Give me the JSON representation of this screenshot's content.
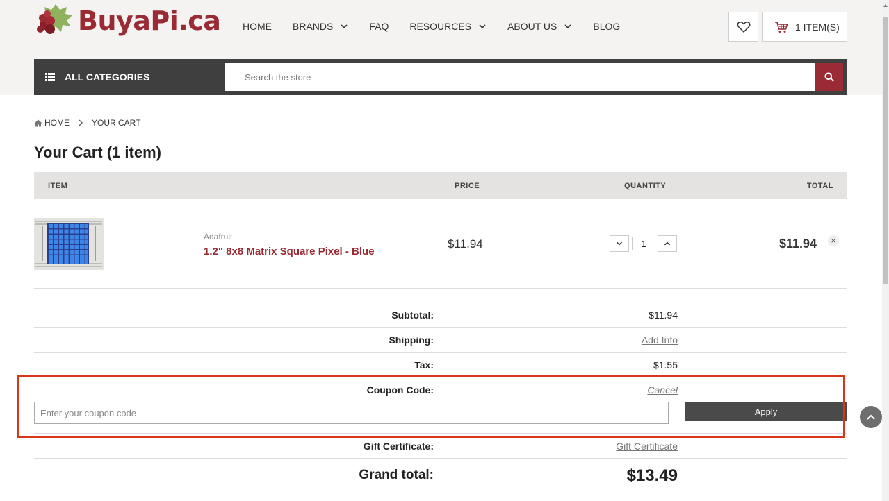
{
  "header": {
    "logo_text": "BuyaPi",
    "logo_tld": ".ca",
    "nav": [
      {
        "label": "HOME",
        "dropdown": false
      },
      {
        "label": "BRANDS",
        "dropdown": true
      },
      {
        "label": "FAQ",
        "dropdown": false
      },
      {
        "label": "RESOURCES",
        "dropdown": true
      },
      {
        "label": "ABOUT US",
        "dropdown": true
      },
      {
        "label": "BLOG",
        "dropdown": false
      }
    ],
    "cart_label": "1 ITEM(S)",
    "categories_label": "ALL CATEGORIES",
    "search_placeholder": "Search the store"
  },
  "breadcrumb": {
    "home": "HOME",
    "current": "YOUR CART"
  },
  "page_title": "Your Cart (1 item)",
  "table": {
    "headers": {
      "item": "ITEM",
      "price": "PRICE",
      "quantity": "QUANTITY",
      "total": "TOTAL"
    },
    "rows": [
      {
        "brand": "Adafruit",
        "name": "1.2\" 8x8 Matrix Square Pixel - Blue",
        "price": "$11.94",
        "quantity": "1",
        "total": "$11.94",
        "remove": "×"
      }
    ]
  },
  "summary": {
    "subtotal_label": "Subtotal:",
    "subtotal_value": "$11.94",
    "shipping_label": "Shipping:",
    "shipping_value": "Add Info",
    "tax_label": "Tax:",
    "tax_value": "$1.55",
    "coupon_label": "Coupon Code:",
    "coupon_cancel": "Cancel",
    "coupon_placeholder": "Enter your coupon code",
    "apply_label": "Apply",
    "gift_label": "Gift Certificate:",
    "gift_value": "Gift Certificate",
    "grand_total_label": "Grand total:",
    "grand_total_value": "$13.49"
  },
  "colors": {
    "brand": "#9a2a33",
    "dark_bar": "#3f3f3f",
    "highlight": "#d9351b"
  },
  "icons": [
    "raspberry-logo-icon",
    "heart-icon",
    "cart-icon",
    "list-icon",
    "search-icon",
    "home-icon",
    "chevron-right-icon",
    "chevron-down-icon",
    "chevron-up-icon",
    "close-icon",
    "arrow-up-icon"
  ]
}
